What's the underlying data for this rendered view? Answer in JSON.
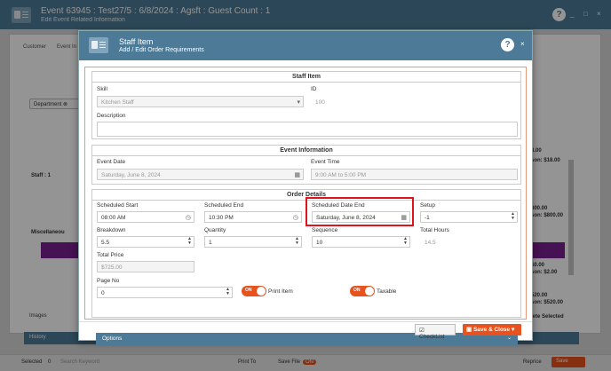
{
  "app": {
    "title": "Event 63945 : Test27/5 : 6/8/2024 : Agsft : Guest Count : 1",
    "subtitle": "Edit Event Related Information",
    "help": "?",
    "minimize": "_",
    "maximize": "□",
    "close": "×"
  },
  "background": {
    "tabs": [
      "Customer",
      "Event In"
    ],
    "department_chip": "Department",
    "staff_row": "Staff : 1",
    "misc_row": "Miscellaneou",
    "right_values": [
      "8.00",
      "son: $18.00",
      "800.00",
      "son: $800.00",
      "$0.00",
      "son: $2.00",
      "520.00",
      "son: $520.00",
      "lete Selected"
    ],
    "images": "Images",
    "history": "History",
    "footer": {
      "selected": "Selected",
      "selected_count": "0",
      "search_placeholder": "Search Keyword",
      "print_to": "Print To",
      "save_file": "Save File",
      "save_file_toggle": "ON",
      "reprice": "Reprice",
      "save": "Save"
    }
  },
  "modal": {
    "title": "Staff Item",
    "subtitle": "Add / Edit Order Requirements",
    "help": "?",
    "close": "×",
    "staff_item": {
      "section_title": "Staff Item",
      "skill_label": "Skill",
      "skill_value": "Kitchen Staff",
      "id_label": "ID",
      "id_value": "100",
      "description_label": "Description",
      "description_value": ""
    },
    "event_info": {
      "section_title": "Event Information",
      "event_date_label": "Event Date",
      "event_date_value": "Saturday, June 8, 2024",
      "event_time_label": "Event Time",
      "event_time_value": "9:00 AM to 5:00 PM"
    },
    "order_details": {
      "section_title": "Order Details",
      "scheduled_start_label": "Scheduled Start",
      "scheduled_start_value": "08:00 AM",
      "scheduled_end_label": "Scheduled End",
      "scheduled_end_value": "10:30 PM",
      "scheduled_date_end_label": "Scheduled Date End",
      "scheduled_date_end_value": "Saturday, June 8, 2024",
      "setup_label": "Setup",
      "setup_value": "-1",
      "breakdown_label": "Breakdown",
      "breakdown_value": "5.5",
      "quantity_label": "Quantity",
      "quantity_value": "1",
      "sequence_label": "Sequence",
      "sequence_value": "10",
      "total_hours_label": "Total Hours",
      "total_hours_value": "14.5",
      "total_price_label": "Total Price",
      "total_price_value": "$725.00",
      "page_no_label": "Page No",
      "page_no_value": "0",
      "print_item_label": "Print Item",
      "print_item_toggle": "ON",
      "taxable_label": "Taxable",
      "taxable_toggle": "ON"
    },
    "options_label": "Options",
    "checklist_label": "CheckList",
    "save_close_label": "Save & Close"
  },
  "colors": {
    "header": "#4d7a96",
    "accent": "#e8521e",
    "highlight": "#e0121b",
    "purple": "#7b1f8f"
  }
}
